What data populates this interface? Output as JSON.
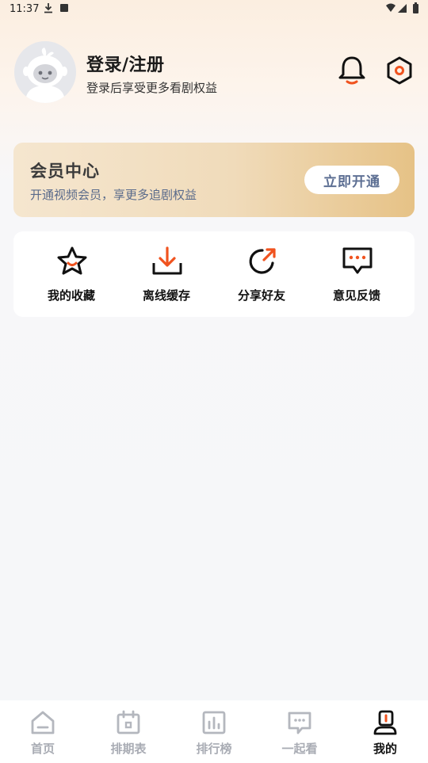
{
  "status_bar": {
    "time": "11:37"
  },
  "profile": {
    "title": "登录/注册",
    "subtitle": "登录后享受更多看剧权益"
  },
  "vip": {
    "title": "会员中心",
    "subtitle": "开通视频会员，享更多追剧权益",
    "button_label": "立即开通"
  },
  "features": [
    {
      "label": "我的收藏",
      "icon": "star-icon"
    },
    {
      "label": "离线缓存",
      "icon": "download-icon"
    },
    {
      "label": "分享好友",
      "icon": "share-icon"
    },
    {
      "label": "意见反馈",
      "icon": "feedback-icon"
    }
  ],
  "tabs": [
    {
      "label": "首页",
      "icon": "home-icon",
      "active": false
    },
    {
      "label": "排期表",
      "icon": "calendar-icon",
      "active": false
    },
    {
      "label": "排行榜",
      "icon": "ranking-icon",
      "active": false
    },
    {
      "label": "一起看",
      "icon": "chat-icon",
      "active": false
    },
    {
      "label": "我的",
      "icon": "profile-icon",
      "active": true
    }
  ],
  "colors": {
    "accent": "#f0531f",
    "vip_text": "#5a6b8b",
    "tab_inactive": "#a9acb4"
  }
}
